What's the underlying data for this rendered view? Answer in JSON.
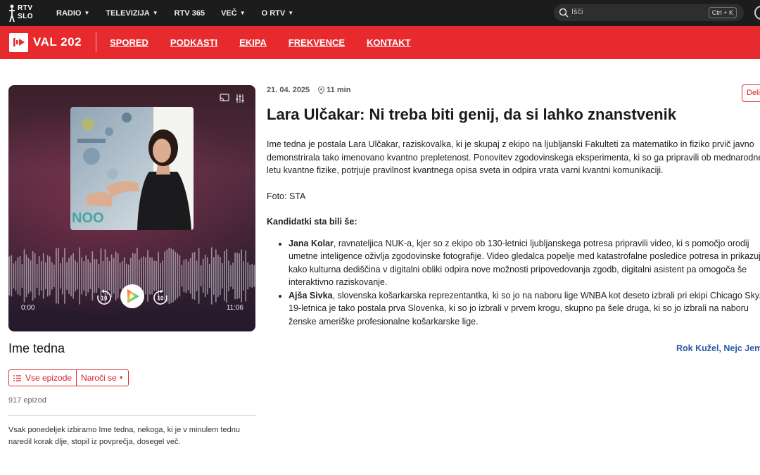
{
  "topbar": {
    "logo_line1": "RTV",
    "logo_line2": "SLO",
    "nav": [
      "RADIO",
      "TELEVIZIJA",
      "RTV 365",
      "VEČ",
      "O RTV"
    ],
    "nav_has_caret": [
      true,
      true,
      false,
      true,
      true
    ],
    "search_placeholder": "Išči",
    "search_shortcut": "Ctrl + K"
  },
  "station": {
    "name": "VAL 202",
    "nav": [
      "SPORED",
      "PODKASTI",
      "EKIPA",
      "FREKVENCE",
      "KONTAKT"
    ],
    "brand_color": "#e62a2e"
  },
  "player": {
    "time_current": "0:00",
    "time_total": "11:06",
    "skip_back_label": "10",
    "skip_forward_label": "10"
  },
  "show": {
    "title": "Ime tedna",
    "all_episodes_label": "Vse epizode",
    "subscribe_label": "Naroči se",
    "episode_count": "917 epizod",
    "description": "Vsak ponedeljek izbiramo Ime tedna, nekoga, ki je v minulem tednu naredil korak dlje, stopil iz povprečja, dosegel več."
  },
  "article": {
    "date": "21. 04. 2025",
    "duration": "11 min",
    "share_label": "Deli",
    "headline": "Lara Ulčakar: Ni treba biti genij, da si lahko znanstvenik",
    "paragraph": "Ime tedna je postala Lara Ulčakar, raziskovalka, ki je skupaj z ekipo na ljubljanski Fakulteti za matematiko in fiziko prvič javno demonstrirala tako imenovano kvantno prepletenost. Ponovitev zgodovinskega eksperimenta, ki so ga pripravili ob mednarodnem letu kvantne fizike, potrjuje pravilnost kvantnega opisa sveta in odpira vrata varni kvantni komunikaciji.",
    "photo_credit": "Foto: STA",
    "candidates_heading": "Kandidatki sta bili še:",
    "candidates": [
      {
        "name": "Jana Kolar",
        "text": ", ravnateljica NUK-a, kjer so z ekipo ob 130-letnici ljubljanskega potresa pripravili video, ki s pomočjo orodij umetne inteligence oživlja zgodovinske fotografije. Video gledalca popelje med katastrofalne posledice potresa in prikazuje, kako kulturna dediščina v digitalni obliki odpira nove možnosti pripovedovanja zgodb, digitalni asistent pa omogoča še interaktivno raziskovanje."
      },
      {
        "name": "Ajša Sivka",
        "text": ", slovenska košarkarska reprezentantka, ki so jo na naboru lige WNBA kot deseto izbrali pri ekipi Chicago Sky. 19-letnica je tako postala prva Slovenka, ki so jo izbrali v prvem krogu, skupno pa šele druga, ki so jo izbrali na naboru ženske ameriške profesionalne košarkarske lige."
      }
    ],
    "authors": "Rok Kužel, Nejc Jemec"
  }
}
